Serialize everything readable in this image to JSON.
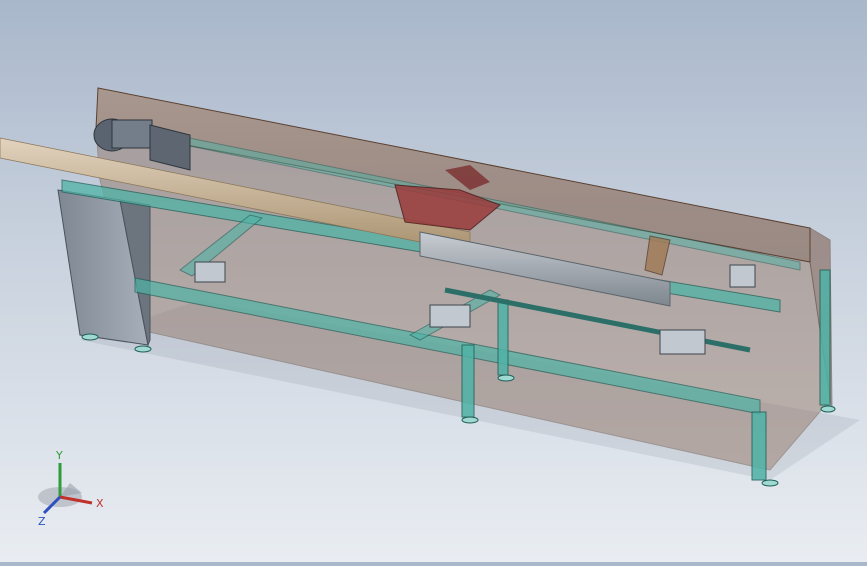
{
  "triad": {
    "x_label": "X",
    "y_label": "Y",
    "z_label": "Z"
  },
  "colors": {
    "background_top": "#a9b7cb",
    "background_bottom": "#e9edf2",
    "enclosure_fill": "#8c6a55",
    "frame_teal": "#4fb3a6",
    "frame_edge": "#1f5f58",
    "rod": "#c8b49b",
    "roller": "#9ea6ad",
    "motor": "#5a6470",
    "red_carriage": "#9a3b3b",
    "x_axis": "#c0312b",
    "y_axis": "#2f9b3a",
    "z_axis": "#2f4fc0"
  },
  "icons": [
    "coordinate-triad-icon"
  ]
}
